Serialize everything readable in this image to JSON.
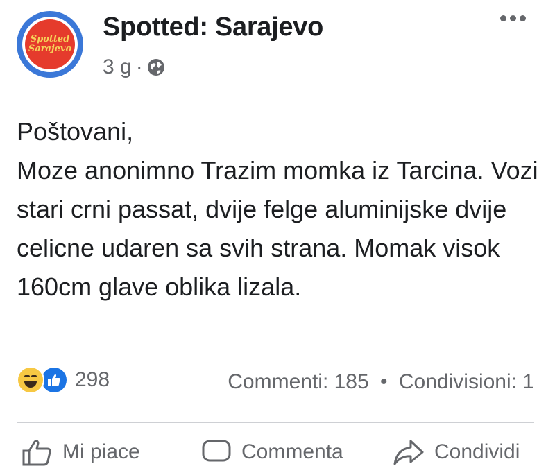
{
  "header": {
    "page_name": "Spotted: Sarajevo",
    "avatar_text_line1": "Spotted",
    "avatar_text_line2": "Sarajevo",
    "timestamp": "3 g",
    "separator": "·",
    "privacy_icon": "globe-icon",
    "more_icon": "more-options-icon"
  },
  "post": {
    "text": "Poštovani,\nMoze anonimno Trazim momka iz Tarcina. Vozi stari crni passat, dvije felge aluminijske dvije celicne udaren sa svih strana. Momak visok 160cm glave oblika lizala."
  },
  "stats": {
    "reaction_icons": [
      "haha-icon",
      "like-icon"
    ],
    "reaction_count": "298",
    "comments": "Commenti: 185",
    "separator": "•",
    "shares": "Condivisioni: 1"
  },
  "actions": {
    "like_label": "Mi piace",
    "comment_label": "Commenta",
    "share_label": "Condividi"
  },
  "colors": {
    "avatar_ring": "#3b78d8",
    "avatar_fill": "#e53b2c",
    "like_blue": "#1b74e4",
    "haha_yellow": "#f7c843",
    "secondary_text": "#65676b"
  }
}
